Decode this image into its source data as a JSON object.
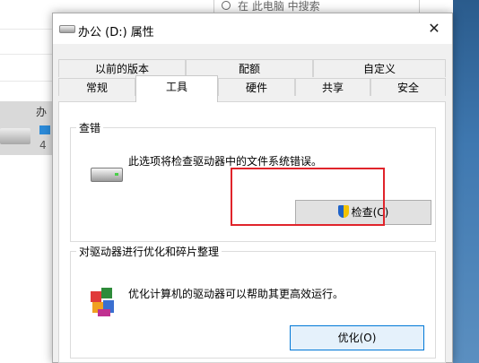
{
  "background": {
    "search_placeholder": "在 此电脑 中搜索",
    "drive_label": "办",
    "drive_number": "4"
  },
  "dialog": {
    "title": "办公 (D:) 属性",
    "close_glyph": "✕",
    "tabs_row1": [
      {
        "label": "以前的版本"
      },
      {
        "label": "配额"
      },
      {
        "label": "自定义"
      }
    ],
    "tabs_row2": [
      {
        "label": "常规"
      },
      {
        "label": "工具",
        "active": true
      },
      {
        "label": "硬件"
      },
      {
        "label": "共享"
      },
      {
        "label": "安全"
      }
    ]
  },
  "error_check": {
    "title": "查错",
    "description": "此选项将检查驱动器中的文件系统错误。",
    "button_label": "检查(C)",
    "icon": "shield-icon"
  },
  "optimize": {
    "title": "对驱动器进行优化和碎片整理",
    "description": "优化计算机的驱动器可以帮助其更高效运行。",
    "button_label": "优化(O)",
    "icon": "defrag-icon"
  },
  "colors": {
    "highlight": "#e0242b",
    "accent": "#0078d7"
  }
}
